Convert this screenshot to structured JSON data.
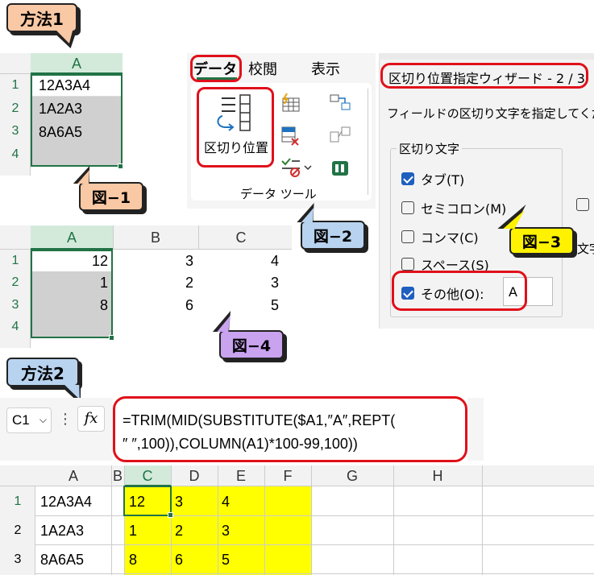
{
  "method1": {
    "label": "方法1"
  },
  "fig1": {
    "col_header": "A",
    "rows": [
      {
        "num": "1",
        "value": "12A3A4"
      },
      {
        "num": "2",
        "value": "1A2A3"
      },
      {
        "num": "3",
        "value": "8A6A5"
      },
      {
        "num": "4",
        "value": ""
      }
    ],
    "label": "図−1"
  },
  "ribbon": {
    "tabs": [
      "データ",
      "校閲",
      "表示"
    ],
    "split_button": "区切り位置",
    "group_label": "データ ツール"
  },
  "fig2": {
    "label": "図−2"
  },
  "dialog": {
    "title": "区切り位置指定ウィザード - 2 / 3",
    "instruction": "フィールドの区切り文字を指定してくだ",
    "group_title": "区切り文字",
    "options": [
      {
        "label": "タブ(T)",
        "checked": true
      },
      {
        "label": "セミコロン(M)",
        "checked": false
      },
      {
        "label": "コンマ(C)",
        "checked": false
      },
      {
        "label": "スペース(S)",
        "checked": false
      },
      {
        "label": "その他(O):",
        "checked": true
      }
    ],
    "other_value": "A",
    "side_text": "文字"
  },
  "fig3": {
    "label": "図−3"
  },
  "fig4": {
    "col_headers": [
      "A",
      "B",
      "C"
    ],
    "rows": [
      {
        "num": "1",
        "values": [
          "12",
          "3",
          "4"
        ]
      },
      {
        "num": "2",
        "values": [
          "1",
          "2",
          "3"
        ]
      },
      {
        "num": "3",
        "values": [
          "8",
          "6",
          "5"
        ]
      },
      {
        "num": "4",
        "values": [
          "",
          "",
          ""
        ]
      }
    ],
    "label": "図−4"
  },
  "method2": {
    "label": "方法2"
  },
  "formula_bar": {
    "name_box": "C1",
    "fx": "fx",
    "formula_line1": "=TRIM(MID(SUBSTITUTE($A1,″A″,REPT(",
    "formula_line2": "″ ″,100)),COLUMN(A1)*100-99,100))"
  },
  "sheet2": {
    "col_headers": [
      "A",
      "B",
      "C",
      "D",
      "E",
      "F",
      "G",
      "H"
    ],
    "rows": [
      {
        "num": "1",
        "a": "12A3A4",
        "c": "12",
        "d": "3",
        "e": "4"
      },
      {
        "num": "2",
        "a": "1A2A3",
        "c": "1",
        "d": "2",
        "e": "3"
      },
      {
        "num": "3",
        "a": "8A6A5",
        "c": "8",
        "d": "6",
        "e": "5"
      }
    ]
  },
  "colors": {
    "callout_orange": "#f9c8a4",
    "callout_blue": "#b8d3ef",
    "callout_yellow": "#fff200",
    "callout_purple": "#c9a3f0",
    "highlight_yellow": "#ffff00",
    "red": "#e0101a",
    "excel_green": "#217346"
  }
}
